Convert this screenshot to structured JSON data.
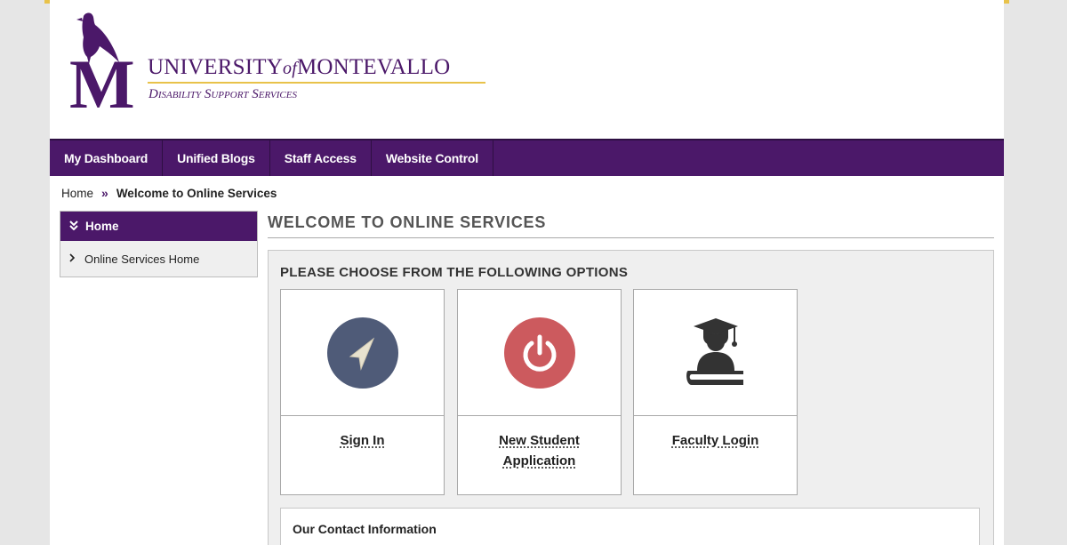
{
  "brand": {
    "logo_letter": "M",
    "name_part1": "UNIVERSITY",
    "name_of": "of",
    "name_part2": "MONTEVALLO",
    "department": "Disability Support Services",
    "brand_color": "#4b1869",
    "accent_color": "#e8c24a"
  },
  "nav": {
    "items": [
      {
        "label": "My Dashboard"
      },
      {
        "label": "Unified Blogs"
      },
      {
        "label": "Staff Access"
      },
      {
        "label": "Website Control"
      }
    ]
  },
  "breadcrumb": {
    "home": "Home",
    "separator": "»",
    "current": "Welcome to Online Services"
  },
  "sidebar": {
    "header_icon": "double-chevron-down-icon",
    "header": "Home",
    "items": [
      {
        "icon": "chevron-right-icon",
        "label": "Online Services Home"
      }
    ]
  },
  "main": {
    "title": "WELCOME TO ONLINE SERVICES",
    "panel_title": "PLEASE CHOOSE FROM THE FOLLOWING OPTIONS",
    "cards": [
      {
        "label": "Sign In",
        "icon": "cursor-arrow-icon",
        "color": "#4f5b78"
      },
      {
        "label": "New Student Application",
        "icon": "power-icon",
        "color": "#cc5a5e"
      },
      {
        "label": "Faculty Login",
        "icon": "graduate-book-icon",
        "color": "#333333"
      }
    ],
    "contact_title": "Our Contact Information"
  }
}
